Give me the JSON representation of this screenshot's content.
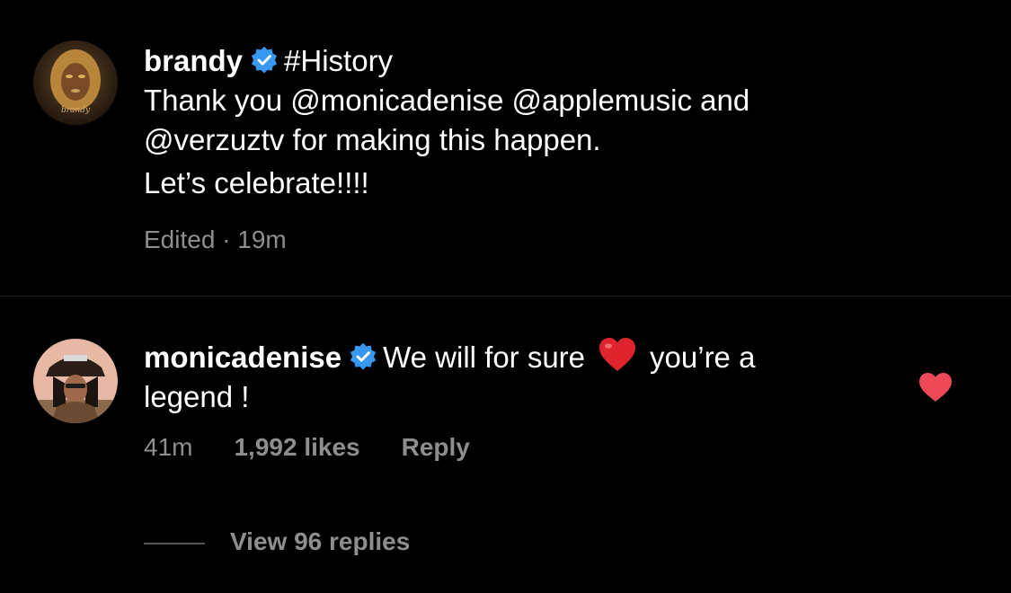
{
  "post": {
    "username": "brandy",
    "hashtag": "#History",
    "line1": "Thank you @monicadenise @applemusic and",
    "line2": "@verzuztv for making this happen.",
    "line3": "Let’s celebrate!!!!",
    "meta": "Edited · 19m",
    "avatar_label": "brandy"
  },
  "comment": {
    "username": "monicadenise",
    "text_before": "We will for sure",
    "emoji": "heart-emoji",
    "text_after": "you’re a",
    "line2": "legend !",
    "time": "41m",
    "likes": "1,992 likes",
    "reply": "Reply",
    "view_replies": "View 96 replies",
    "liked": true
  },
  "colors": {
    "background": "#000000",
    "text": "#ffffff",
    "muted": "#8e8e8e",
    "verified": "#3897f0",
    "like": "#ed4956",
    "divider": "#262626"
  },
  "icons": [
    "verified-badge-icon",
    "heart-emoji",
    "like-heart-icon"
  ]
}
